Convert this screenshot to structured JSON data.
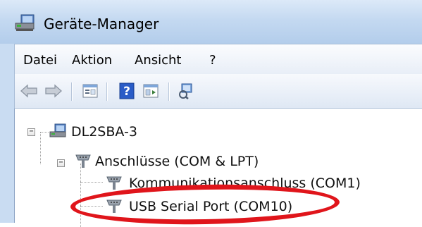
{
  "window": {
    "title": "Geräte-Manager"
  },
  "menu": {
    "items": [
      "Datei",
      "Aktion",
      "Ansicht",
      "?"
    ]
  },
  "tree": {
    "root": {
      "label": "DL2SBA-3",
      "expander": "−"
    },
    "category": {
      "label": "Anschlüsse (COM & LPT)",
      "expander": "−"
    },
    "devices": [
      {
        "label": "Kommunikationsanschluss (COM1)"
      },
      {
        "label": "USB Serial Port (COM10)"
      }
    ]
  },
  "colors": {
    "highlight": "#e0151b",
    "title_bar": "#c4d9f1"
  },
  "icons": {
    "app": "device-manager-icon",
    "back": "back-arrow-icon",
    "forward": "forward-arrow-icon",
    "properties": "properties-icon",
    "help": "help-icon",
    "view": "view-icon",
    "scan": "scan-hardware-icon"
  }
}
